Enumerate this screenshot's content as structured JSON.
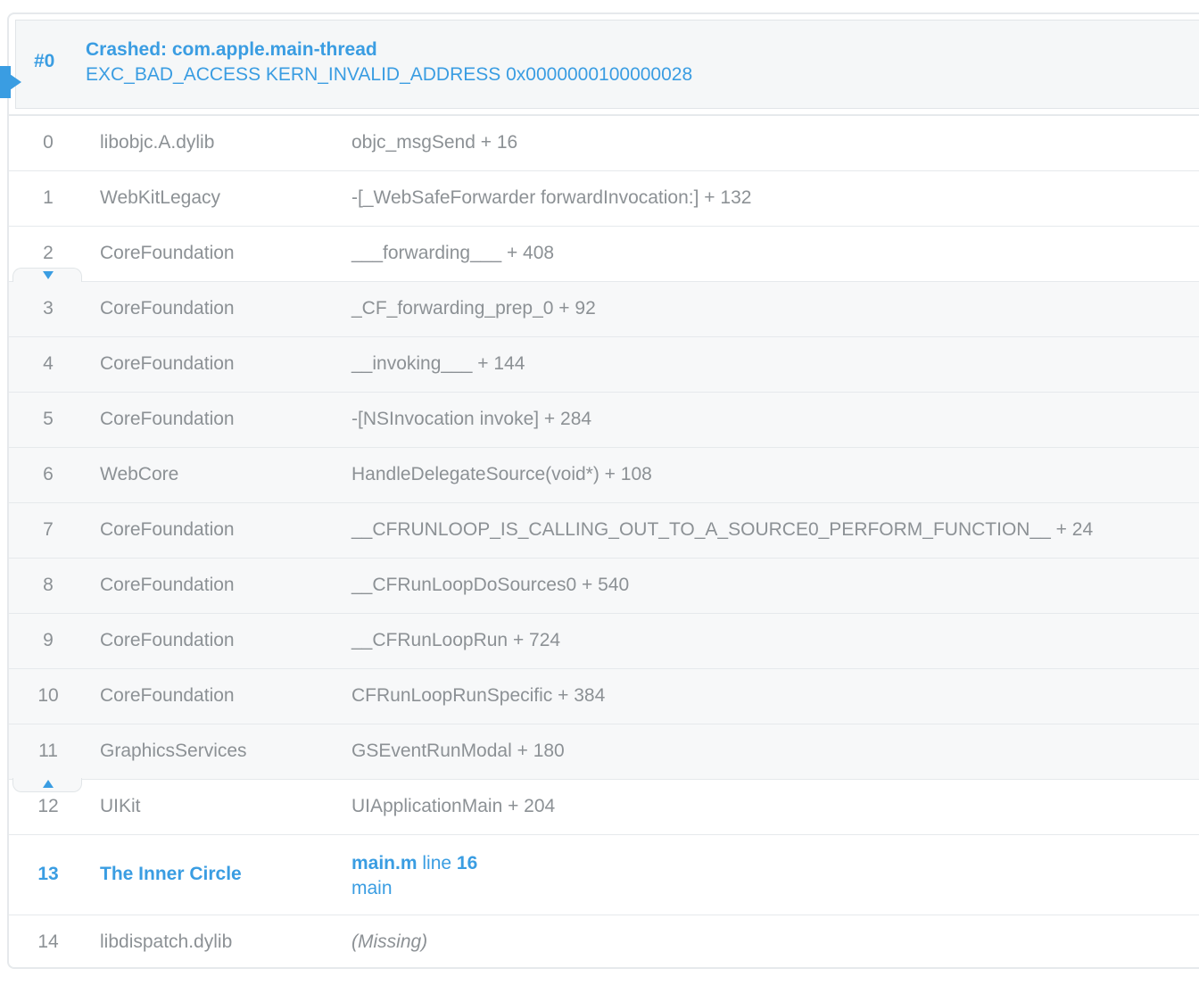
{
  "thread": {
    "id": "#0",
    "title": "Crashed: com.apple.main-thread",
    "exception": "EXC_BAD_ACCESS KERN_INVALID_ADDRESS 0x0000000100000028"
  },
  "frames": [
    {
      "num": "0",
      "lib": "libobjc.A.dylib",
      "sym": "objc_msgSend + 16"
    },
    {
      "num": "1",
      "lib": "WebKitLegacy",
      "sym": "-[_WebSafeForwarder forwardInvocation:] + 132"
    },
    {
      "num": "2",
      "lib": "CoreFoundation",
      "sym": "___forwarding___ + 408"
    },
    {
      "num": "3",
      "lib": "CoreFoundation",
      "sym": "_CF_forwarding_prep_0 + 92"
    },
    {
      "num": "4",
      "lib": "CoreFoundation",
      "sym": "__invoking___ + 144"
    },
    {
      "num": "5",
      "lib": "CoreFoundation",
      "sym": "-[NSInvocation invoke] + 284"
    },
    {
      "num": "6",
      "lib": "WebCore",
      "sym": "HandleDelegateSource(void*) + 108"
    },
    {
      "num": "7",
      "lib": "CoreFoundation",
      "sym": "__CFRUNLOOP_IS_CALLING_OUT_TO_A_SOURCE0_PERFORM_FUNCTION__ + 24"
    },
    {
      "num": "8",
      "lib": "CoreFoundation",
      "sym": "__CFRunLoopDoSources0 + 540"
    },
    {
      "num": "9",
      "lib": "CoreFoundation",
      "sym": "__CFRunLoopRun + 724"
    },
    {
      "num": "10",
      "lib": "CoreFoundation",
      "sym": "CFRunLoopRunSpecific + 384"
    },
    {
      "num": "11",
      "lib": "GraphicsServices",
      "sym": "GSEventRunModal + 180"
    },
    {
      "num": "12",
      "lib": "UIKit",
      "sym": "UIApplicationMain + 204"
    },
    {
      "num": "13",
      "lib": "The Inner Circle",
      "file": "main.m",
      "line_word": "line",
      "line": "16",
      "func": "main"
    },
    {
      "num": "14",
      "lib": "libdispatch.dylib",
      "sym": "(Missing)"
    }
  ],
  "colors": {
    "accent": "#3a9de2",
    "text": "#8c9195",
    "collapsed_bg": "#f7f8f9",
    "border": "#e6e9ec"
  },
  "icons": {
    "blamed_frame": "blamed-frame-marker-icon",
    "collapse_top": "chevron-down-icon",
    "collapse_bottom": "chevron-up-icon"
  }
}
